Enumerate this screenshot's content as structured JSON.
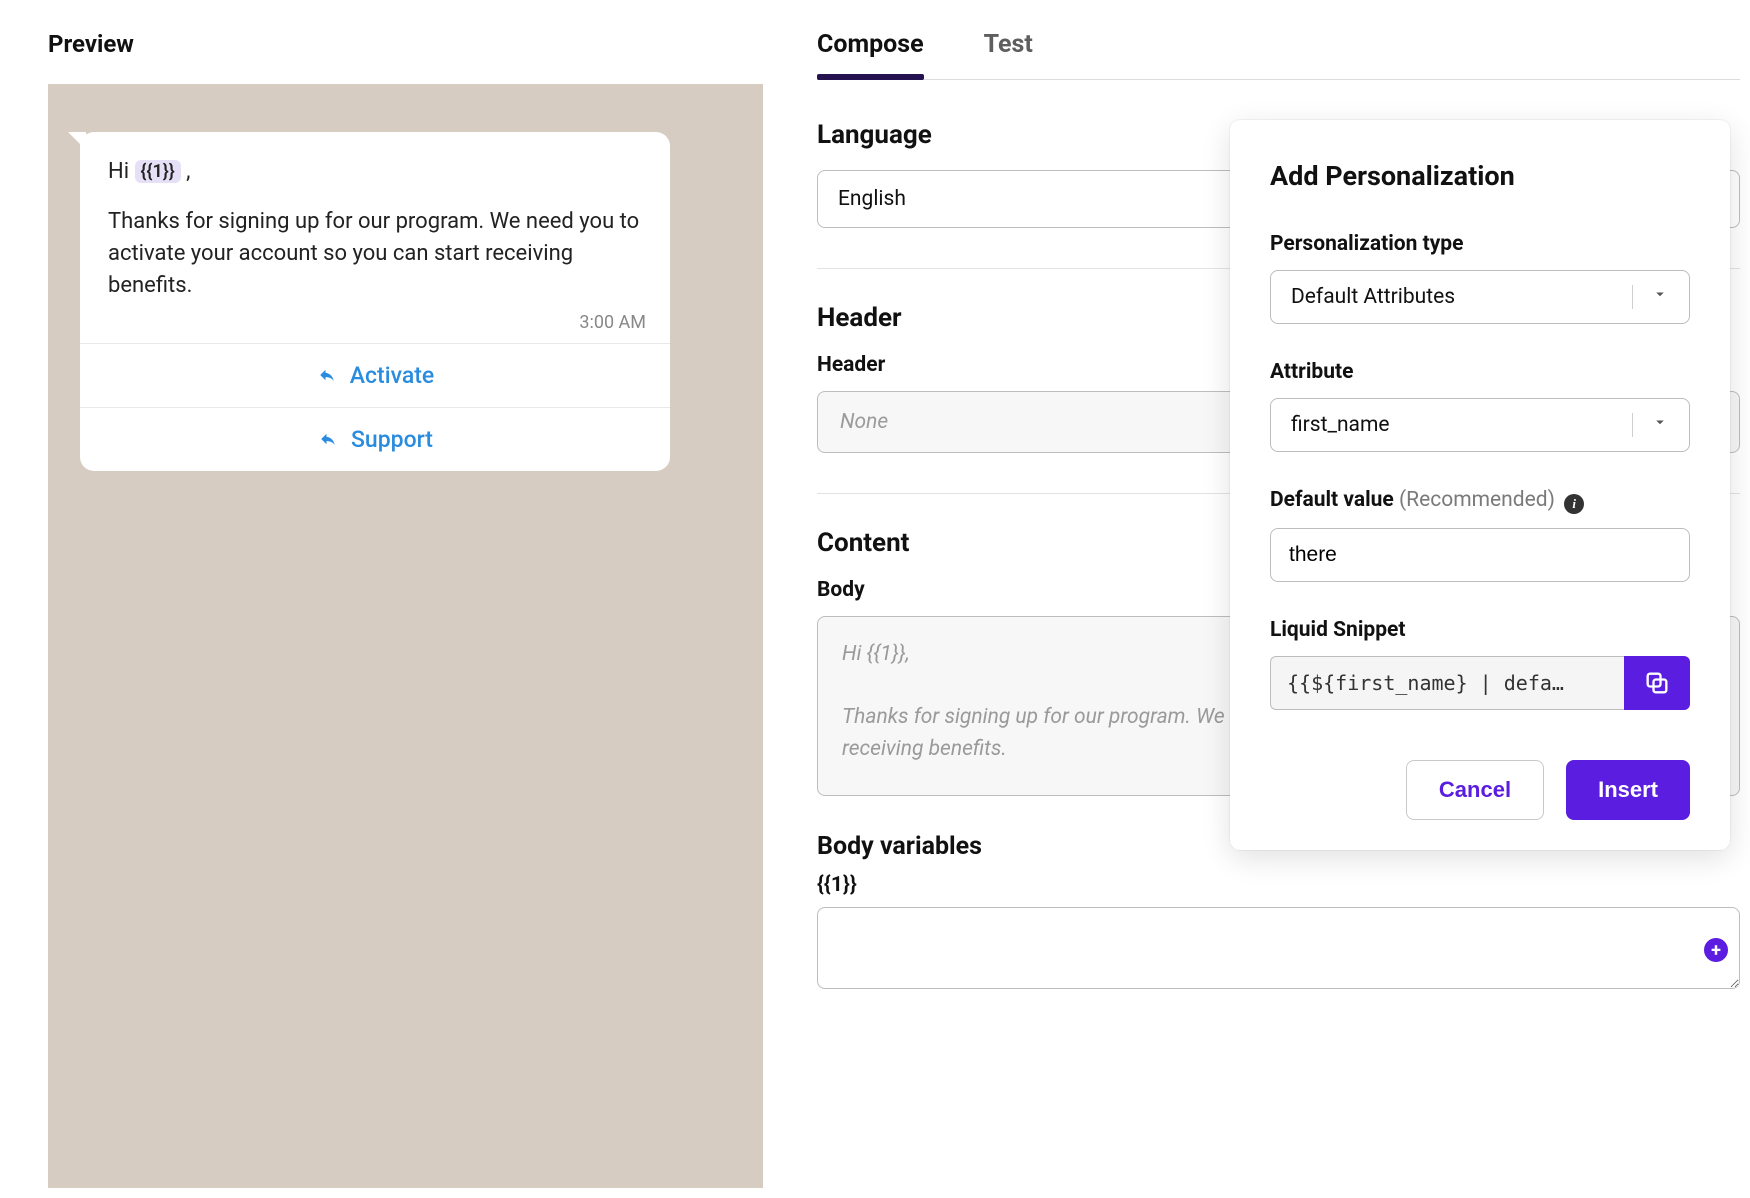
{
  "preview": {
    "title": "Preview",
    "greeting_prefix": "Hi ",
    "greeting_token": "{{1}}",
    "greeting_suffix": " ,",
    "body_text": "Thanks for signing up for our program. We need you to activate your account so you can start receiving benefits.",
    "timestamp": "3:00 AM",
    "actions": [
      "Activate",
      "Support"
    ]
  },
  "tabs": {
    "compose": "Compose",
    "test": "Test"
  },
  "compose": {
    "language_section": "Language",
    "language_value": "English",
    "header_section": "Header",
    "header_label": "Header",
    "header_value": "None",
    "content_section": "Content",
    "body_label": "Body",
    "body_value": "Hi {{1}},\n\nThanks for signing up for our program. We need you to activate your account so you can start receiving benefits.",
    "body_variables_title": "Body variables",
    "body_var_label": "{{1}}"
  },
  "popover": {
    "title": "Add Personalization",
    "type_label": "Personalization type",
    "type_value": "Default Attributes",
    "attribute_label": "Attribute",
    "attribute_value": "first_name",
    "default_label_main": "Default value",
    "default_label_rec": " (Recommended)",
    "default_value": "there",
    "snippet_label": "Liquid Snippet",
    "snippet_value": "{{${first_name} | defa…",
    "cancel": "Cancel",
    "insert": "Insert"
  },
  "colors": {
    "accent": "#5b1de0",
    "link": "#2a8cde",
    "tab_underline": "#241251",
    "preview_bg": "#d7ccc1"
  }
}
